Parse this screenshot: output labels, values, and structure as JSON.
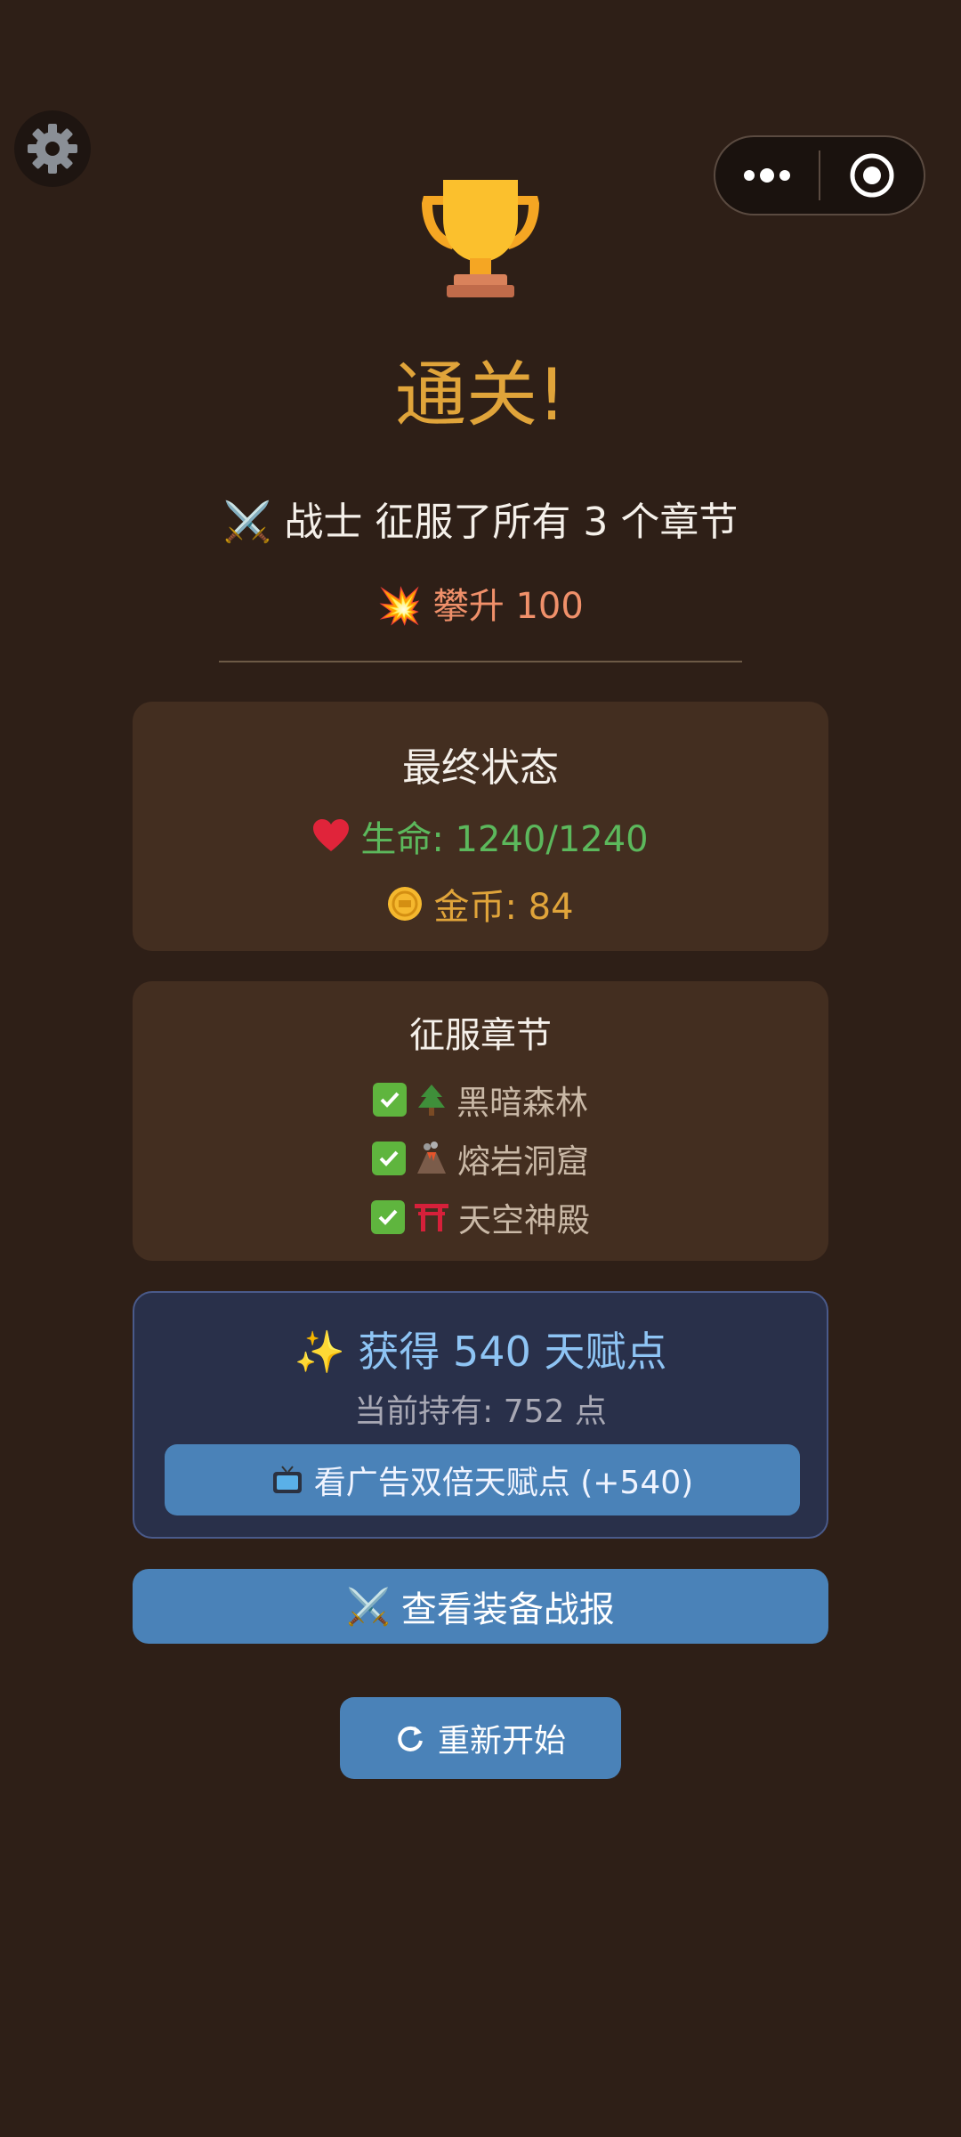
{
  "header": {
    "title": "通关!",
    "subtitle": "战士 征服了所有 3 个章节",
    "ascend": "攀升 100"
  },
  "final_status": {
    "title": "最终状态",
    "hp_label": "生命: 1240/1240",
    "gold_label": "金币: 84"
  },
  "chapters": {
    "title": "征服章节",
    "items": [
      {
        "icon": "tree-icon",
        "name": "黑暗森林"
      },
      {
        "icon": "volcano-icon",
        "name": "熔岩洞窟"
      },
      {
        "icon": "torii-icon",
        "name": "天空神殿"
      }
    ]
  },
  "talent": {
    "title": "获得 540 天赋点",
    "held": "当前持有: 752 点",
    "ad_button": "看广告双倍天赋点 (+540)"
  },
  "buttons": {
    "report": "查看装备战报",
    "restart": "重新开始"
  },
  "colors": {
    "background": "#2e1f17",
    "gold": "#e0a43a",
    "hp": "#5cb85c",
    "button": "#4a82b8"
  }
}
